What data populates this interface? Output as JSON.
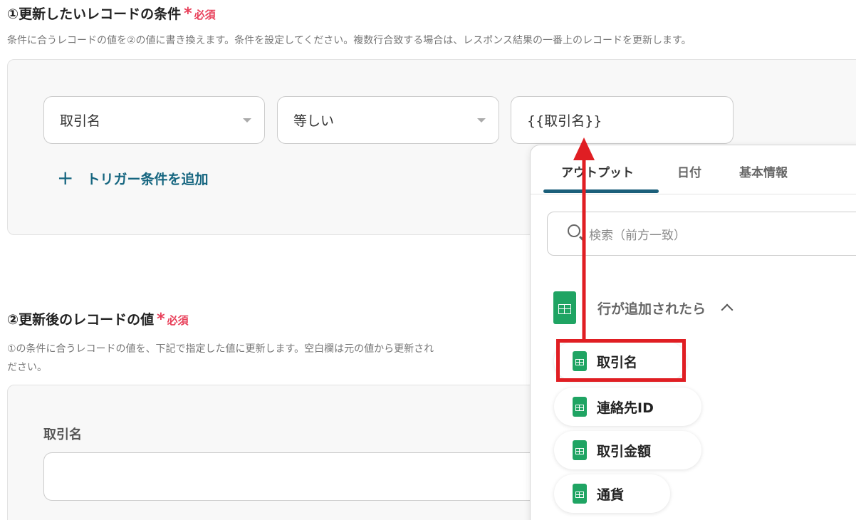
{
  "section1": {
    "title": "①更新したいレコードの条件",
    "required_star": "*",
    "required_text": "必須",
    "description": "条件に合うレコードの値を②の値に書き換えます。条件を設定してください。複数行合致する場合は、レスポンス結果の一番上のレコードを更新します。",
    "field_select": "取引名",
    "operator_select": "等しい",
    "value_input": "{{取引名}}",
    "add_condition_icon": "+",
    "add_condition_label": "トリガー条件を追加"
  },
  "section2": {
    "title": "②更新後のレコードの値",
    "required_star": "*",
    "required_text": "必須",
    "description": "①の条件に合うレコードの値を、下記で指定した値に更新します。空白欄は元の値から更新され",
    "description_line2": "ださい。",
    "field_label": "取引名",
    "field_value": ""
  },
  "popup": {
    "tabs": [
      {
        "label": "アウトプット",
        "active": true
      },
      {
        "label": "日付",
        "active": false
      },
      {
        "label": "基本情報",
        "active": false
      }
    ],
    "search_placeholder": "検索（前方一致）",
    "group_label": "行が追加されたら",
    "group_icon": "google-sheets-icon",
    "items": [
      {
        "label": "取引名",
        "highlighted": true
      },
      {
        "label": "連絡先ID",
        "highlighted": false
      },
      {
        "label": "取引金額",
        "highlighted": false
      },
      {
        "label": "通貨",
        "highlighted": false
      }
    ]
  },
  "colors": {
    "accent": "#166680",
    "required": "#e8405a",
    "sheets_green": "#1fa463",
    "annotation_red": "#e01e23",
    "tab_underline": "#1b5f7a"
  }
}
